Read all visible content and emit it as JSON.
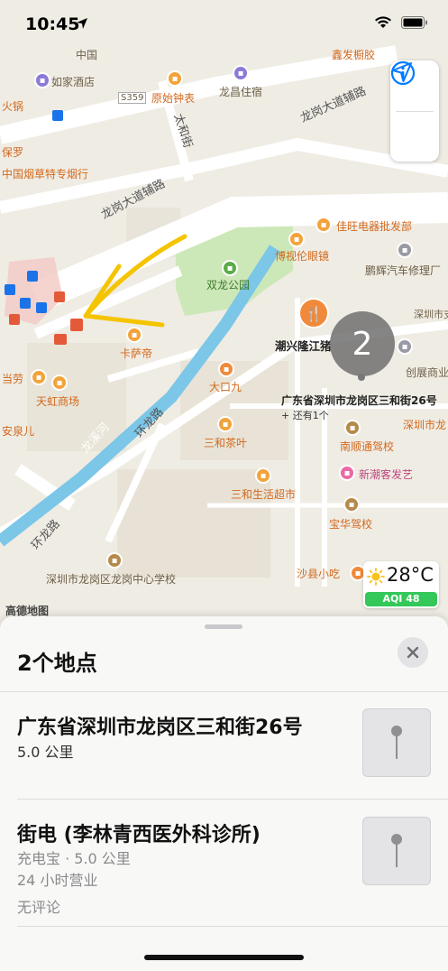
{
  "status_bar": {
    "time": "10:45"
  },
  "map": {
    "roads": [
      "龙岗大道辅路",
      "龙岗大道辅路",
      "太和街",
      "龙溪河",
      "环龙路",
      "环龙路"
    ],
    "places": [
      {
        "name": "如家酒店"
      },
      {
        "name": "龙昌住宿"
      },
      {
        "name": "原始钟表"
      },
      {
        "name": "火锅"
      },
      {
        "name": "保罗"
      },
      {
        "name": "中国烟草特专烟行"
      },
      {
        "name": "佳旺电器批发部"
      },
      {
        "name": "博视伦眼镜"
      },
      {
        "name": "鹏辉汽车修理厂"
      },
      {
        "name": "双龙公园"
      },
      {
        "name": "卡萨帝"
      },
      {
        "name": "潮兴隆江猪"
      },
      {
        "name": "创展商业"
      },
      {
        "name": "大口九"
      },
      {
        "name": "三和茶叶"
      },
      {
        "name": "南顺通驾校"
      },
      {
        "name": "新潮客发艺"
      },
      {
        "name": "天虹商场"
      },
      {
        "name": "当劳"
      },
      {
        "name": "安泉儿"
      },
      {
        "name": "三和生活超市"
      },
      {
        "name": "宝华驾校"
      },
      {
        "name": "深圳市龙岗区龙岗中心学校"
      },
      {
        "name": "沙县小吃"
      },
      {
        "name": "鑫发橱胶"
      },
      {
        "name": "中国"
      },
      {
        "name": "S359"
      },
      {
        "name": "深圳市支队龙"
      },
      {
        "name": "深圳市龙"
      }
    ],
    "cluster": {
      "count": "2",
      "address": "广东省深圳市龙岗区三和街26号",
      "more": "+ 还有1个"
    },
    "weather": {
      "temp": "28°C",
      "aqi": "AQI 48"
    },
    "logo": "高德地图"
  },
  "sheet": {
    "title": "2个地点",
    "results": [
      {
        "name": "广东省深圳市龙岗区三和街26号",
        "distance": "5.0 公里"
      },
      {
        "name": "街电 (李林青西医外科诊所)",
        "category": "充电宝 · 5.0 公里",
        "hours": "24 小时营业",
        "reviews": "无评论"
      }
    ]
  },
  "colors": {
    "park": "#cde8b8",
    "river": "#7cc6e8",
    "accent": "#007aff",
    "orange_poi": "#f3a33b",
    "annotation": "#f5c400"
  }
}
